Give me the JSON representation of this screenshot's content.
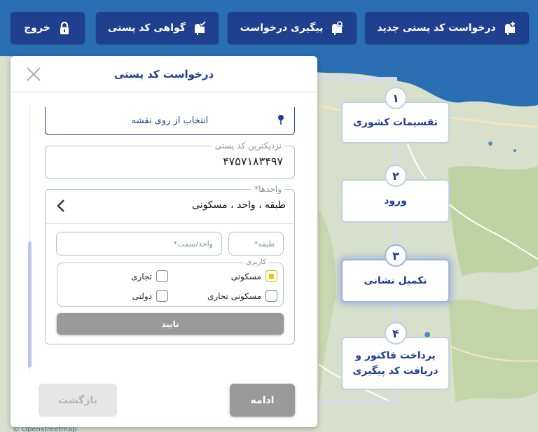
{
  "colors": {
    "brand": "#1f3f8f",
    "sea": "#2a6fb3",
    "land": "#d6dfc9",
    "disabled": "#9a9a9a",
    "check": "#f2c400"
  },
  "toolbar": {
    "new_request": {
      "label": "درخواست کد پستی جدید",
      "icon": "mailbox-plus-icon"
    },
    "track_request": {
      "label": "پیگیری درخواست",
      "icon": "mailbox-search-icon"
    },
    "certificate": {
      "label": "گواهی کد پستی",
      "icon": "mailbox-check-icon"
    },
    "logout": {
      "label": "خروج",
      "icon": "lock-icon"
    }
  },
  "steps": [
    {
      "number": "۱",
      "label": "تقسیمات کشوری",
      "active": false
    },
    {
      "number": "۲",
      "label": "ورود",
      "active": false
    },
    {
      "number": "۳",
      "label": "تکمیل نشانی",
      "active": true
    },
    {
      "number": "۴",
      "label": "پرداخت فاکتور و دریافت کد پیگیری",
      "active": false
    }
  ],
  "dialog": {
    "title": "درخواست کد پستی",
    "map_pick": "انتخاب از روی نقشه",
    "nearest_postal": {
      "label": "نزدیکترین کد پستی",
      "value": "۴۷۵۷۱۸۳۴۹۷"
    },
    "units": {
      "label": "واحدها*",
      "summary": "طبقه ، واحد ، مسکونی",
      "floor_placeholder": "طبقه*",
      "unit_placeholder": "واحد/سمت*",
      "usage": {
        "label": "کاربری",
        "options": [
          {
            "label": "مسکونی",
            "checked": true
          },
          {
            "label": "تجاری",
            "checked": false
          },
          {
            "label": "مسکونی تجاری",
            "checked": false
          },
          {
            "label": "دولتی",
            "checked": false
          }
        ]
      },
      "confirm": "تایید"
    },
    "next": "ادامه",
    "back": "بازگشت"
  },
  "map_credit": "© Openstreetmap"
}
